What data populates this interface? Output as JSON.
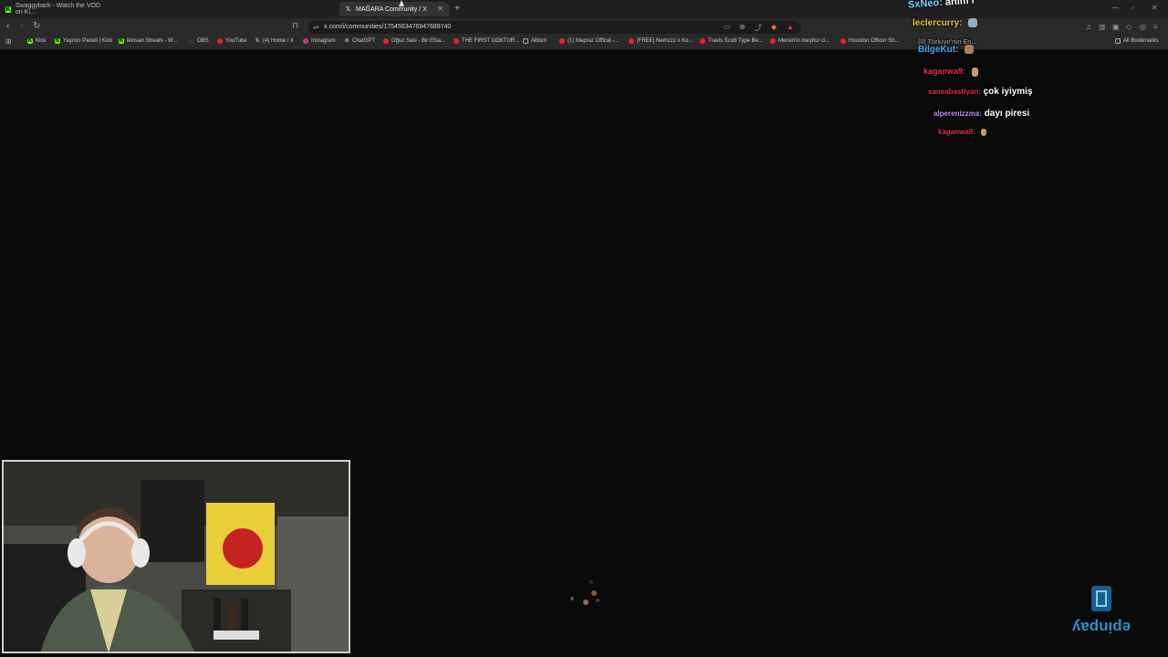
{
  "tabs": [
    {
      "title": "Swaggybark - Watch the VOD on Ki...",
      "favicon": "kick-icon"
    },
    {
      "title": "MAĞARA Community / X",
      "favicon": "x-icon"
    }
  ],
  "address": {
    "url": "x.com/i/communities/1754563476947689740"
  },
  "bookmarks": [
    {
      "label": "Kick",
      "icon": "kick"
    },
    {
      "label": "Yayıncı Paneli | Kick",
      "icon": "kick"
    },
    {
      "label": "ikinsan Stream - W...",
      "icon": "kick"
    },
    {
      "label": "OBS",
      "icon": "obs"
    },
    {
      "label": "YouTube",
      "icon": "yt"
    },
    {
      "label": "(4) Home / X",
      "icon": "x"
    },
    {
      "label": "Instagram",
      "icon": "ig"
    },
    {
      "label": "ChatGPT",
      "icon": "gpt"
    },
    {
      "label": "Oğuz Sasi - Bir Efsa...",
      "icon": "yt"
    },
    {
      "label": "THE FIRST GOKTUR...",
      "icon": "yt"
    },
    {
      "label": "Albüm",
      "icon": "folder"
    },
    {
      "label": "(1) Mepraz Offical -...",
      "icon": "yt"
    },
    {
      "label": "[FREE] Nemzzz x Ko...",
      "icon": "yt"
    },
    {
      "label": "Travis Scott Type Be...",
      "icon": "yt"
    },
    {
      "label": "Mersin'in meşhur ci...",
      "icon": "yt"
    },
    {
      "label": "Houston Officer Sh...",
      "icon": "yt"
    },
    {
      "label": "All Bookmarks",
      "icon": "folder"
    }
  ],
  "chat": [
    {
      "user": "SxNeo:",
      "text": "anim r",
      "user_color": "#7fd3ff"
    },
    {
      "user": "leclercurry:",
      "text": "",
      "user_color": "#f0c040"
    },
    {
      "user": "BilgeKut:",
      "text": "",
      "user_color": "#4aa8ff"
    },
    {
      "user": "kaganwa9:",
      "text": "",
      "user_color": "#e0304a"
    },
    {
      "user": "sansabastiyan:",
      "text": "çok iyiymiş",
      "user_color": "#e0304a"
    },
    {
      "user": "alperenizzma:",
      "text": "dayı piresi",
      "user_color": "#c08cff"
    },
    {
      "user": "kaganwa9:",
      "text": "",
      "user_color": "#e0304a"
    }
  ],
  "chat_subline": "(0) Türkiye'nin En...",
  "watermark": {
    "text": "epinpay",
    "color": "#2e8fc9"
  },
  "colors": {
    "tab_bg": "#1f1f1f",
    "toolbar_bg": "#2a2a2a",
    "page_bg": "#0a0a0a"
  }
}
